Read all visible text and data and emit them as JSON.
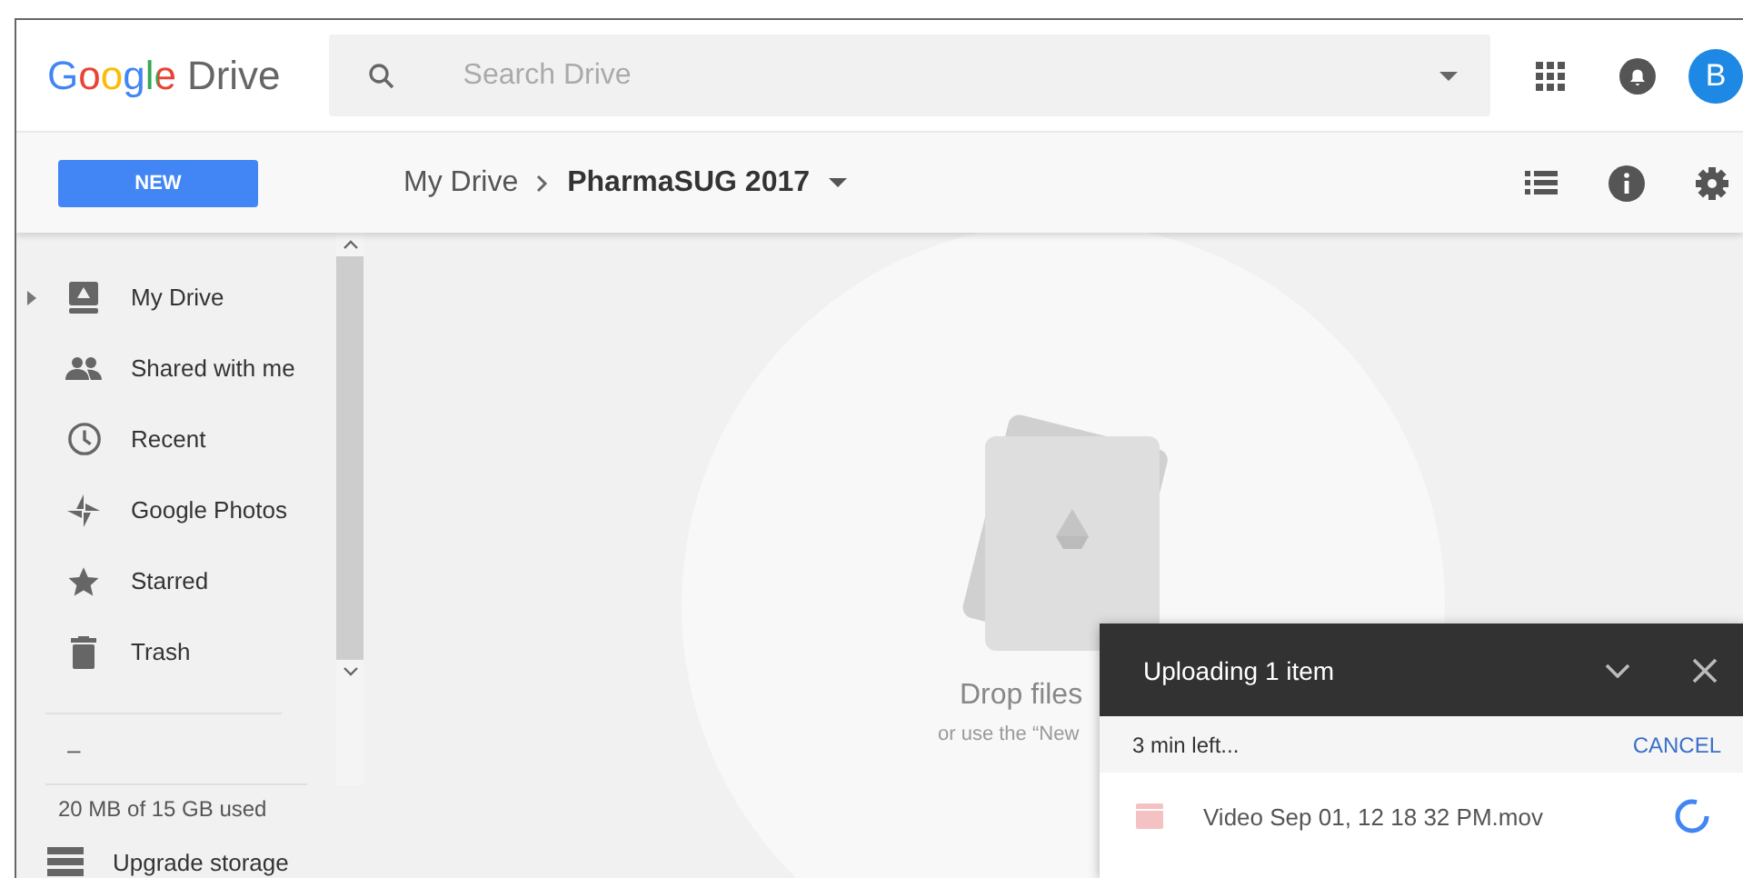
{
  "header": {
    "logo_google": "Google",
    "logo_product": "Drive",
    "search": {
      "placeholder": "Search Drive"
    },
    "avatar": "B"
  },
  "toolbar": {
    "new_button": "NEW",
    "breadcrumb": [
      {
        "label": "My Drive",
        "current": false
      },
      {
        "label": "PharmaSUG 2017",
        "current": true
      }
    ]
  },
  "sidebar": {
    "items": [
      {
        "label": "My Drive",
        "expandable": true
      },
      {
        "label": "Shared with me",
        "expandable": false
      },
      {
        "label": "Recent",
        "expandable": false
      },
      {
        "label": "Google Photos",
        "expandable": false
      },
      {
        "label": "Starred",
        "expandable": false
      },
      {
        "label": "Trash",
        "expandable": false
      }
    ],
    "collapsed_item": "–",
    "storage": "20 MB of 15 GB used",
    "upgrade": "Upgrade storage"
  },
  "drop_zone": {
    "title": "Drop files",
    "hint": "or use the “New"
  },
  "upload_panel": {
    "title": "Uploading 1 item",
    "time_left": "3 min left...",
    "cancel": "CANCEL",
    "files": [
      {
        "name": "Video Sep 01, 12 18 32 PM.mov"
      }
    ]
  }
}
